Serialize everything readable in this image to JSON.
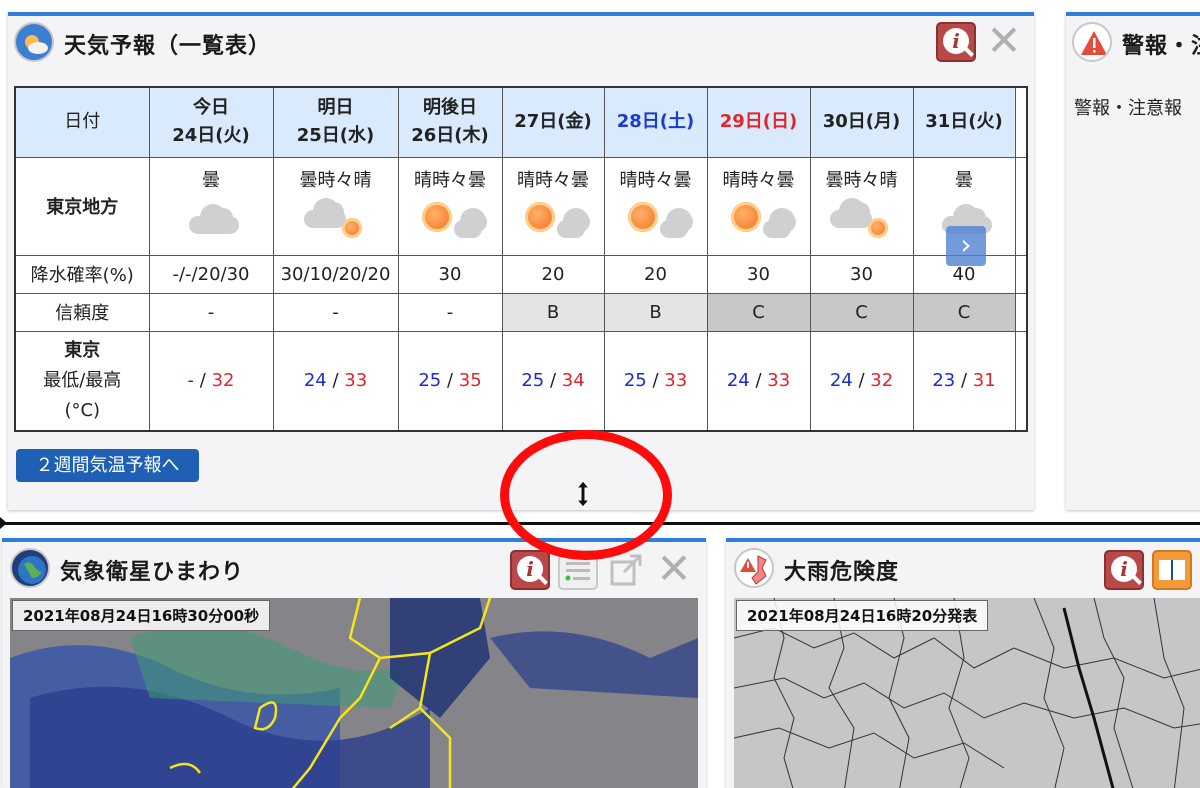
{
  "forecast_panel": {
    "title": "天気予報（一覧表）",
    "region_label": "東京地方",
    "header_label": "日付",
    "days": [
      {
        "line1": "今日",
        "line2": "24日(火)",
        "type": "weekday",
        "weather": "曇",
        "icon": "cloud-icon"
      },
      {
        "line1": "明日",
        "line2": "25日(水)",
        "type": "weekday",
        "weather": "曇時々晴",
        "icon": "cloud-sun-icon"
      },
      {
        "line1": "明後日",
        "line2": "26日(木)",
        "type": "weekday",
        "weather": "晴時々曇",
        "icon": "sun-cloud-icon"
      },
      {
        "line1": "27日(金)",
        "line2": "",
        "type": "weekday",
        "weather": "晴時々曇",
        "icon": "sun-cloud-icon"
      },
      {
        "line1": "28日(土)",
        "line2": "",
        "type": "saturday",
        "weather": "晴時々曇",
        "icon": "sun-cloud-icon"
      },
      {
        "line1": "29日(日)",
        "line2": "",
        "type": "sunday",
        "weather": "晴時々曇",
        "icon": "sun-cloud-icon"
      },
      {
        "line1": "30日(月)",
        "line2": "",
        "type": "weekday",
        "weather": "曇時々晴",
        "icon": "cloud-sun-icon"
      },
      {
        "line1": "31日(火)",
        "line2": "",
        "type": "weekday",
        "weather": "曇",
        "icon": "cloud-icon"
      }
    ],
    "precip_label": "降水確率(%)",
    "precip": [
      "-/-/20/30",
      "30/10/20/20",
      "30",
      "20",
      "20",
      "30",
      "30",
      "40"
    ],
    "reliability_label": "信頼度",
    "reliability": [
      "-",
      "-",
      "-",
      "B",
      "B",
      "C",
      "C",
      "C"
    ],
    "temp_label_city": "東京",
    "temp_label_minmax": "最低/最高",
    "temp_label_unit": "(°C)",
    "temps": [
      {
        "min": "-",
        "max": "32"
      },
      {
        "min": "24",
        "max": "33"
      },
      {
        "min": "25",
        "max": "35"
      },
      {
        "min": "25",
        "max": "34"
      },
      {
        "min": "25",
        "max": "33"
      },
      {
        "min": "24",
        "max": "33"
      },
      {
        "min": "24",
        "max": "32"
      },
      {
        "min": "23",
        "max": "31"
      }
    ],
    "slash": "/",
    "two_week_link": "２週間気温予報へ"
  },
  "warning_panel": {
    "title": "警報・注",
    "body_text": "警報・注意報"
  },
  "satellite_panel": {
    "title": "気象衛星ひまわり",
    "timestamp": "2021年08月24日16時30分00秒"
  },
  "rain_panel": {
    "title": "大雨危険度",
    "timestamp": "2021年08月24日16時20分発表"
  },
  "colors": {
    "accent_blue": "#2f7fd8",
    "saturday": "#1a3ad8",
    "sunday": "#e0262a",
    "annotation_red": "#ff0b0b"
  }
}
